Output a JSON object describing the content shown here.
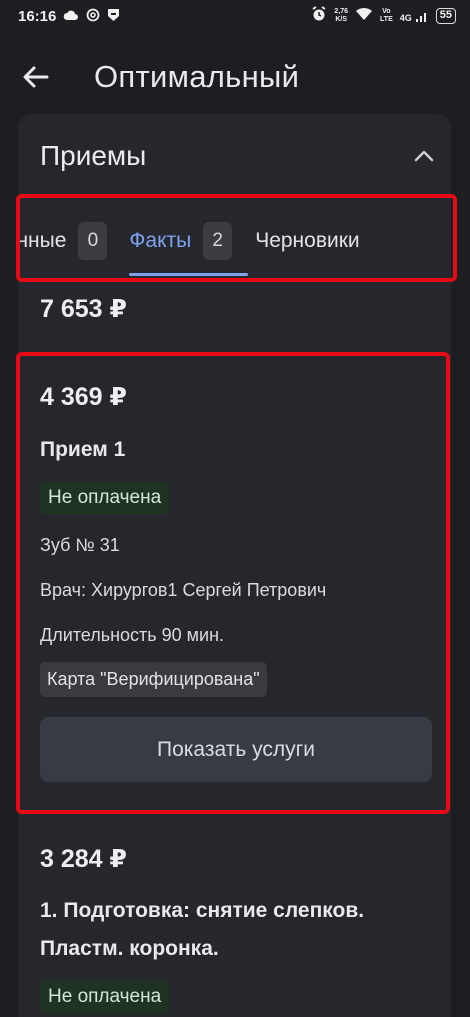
{
  "status_bar": {
    "time": "16:16",
    "left_icons": [
      "cloud-icon",
      "at-icon",
      "shield-icon"
    ],
    "alarm_icon": "alarm-icon",
    "speed_top": "2,76",
    "speed_bottom": "K/S",
    "wifi_icon": "wifi-icon",
    "volte_top": "Vo",
    "volte_bottom": "LTE",
    "network": "4G",
    "battery": "55"
  },
  "app_bar": {
    "back_icon": "arrow-left-icon",
    "title": "Оптимальный"
  },
  "section": {
    "title": "Приемы",
    "collapse_icon": "chevron-up-icon"
  },
  "tabs": [
    {
      "label": "Подтвержденные",
      "count": "0"
    },
    {
      "label": "Факты",
      "count": "2",
      "active": true
    },
    {
      "label": "Черновики"
    }
  ],
  "total_amount": "7 653 ₽",
  "visits": [
    {
      "amount": "4 369 ₽",
      "name": "Прием 1",
      "payment_status": "Не оплачена",
      "tooth": "Зуб № 31",
      "doctor": "Врач: Хирургов1 Сергей Петрович",
      "duration": "Длительность 90 мин.",
      "card_status": "Карта \"Верифицирована\"",
      "show_services_label": "Показать услуги"
    },
    {
      "amount": "3 284 ₽",
      "name_line1": "1. Подготовка: снятие слепков.",
      "name_line2": "Пластм. коронка.",
      "payment_status": "Не оплачена"
    }
  ],
  "colors": {
    "background": "#1d1e22",
    "card": "#26272c",
    "accent": "#7ea2f0",
    "highlight": "#e50a16",
    "status_chip": "#1f3323"
  }
}
